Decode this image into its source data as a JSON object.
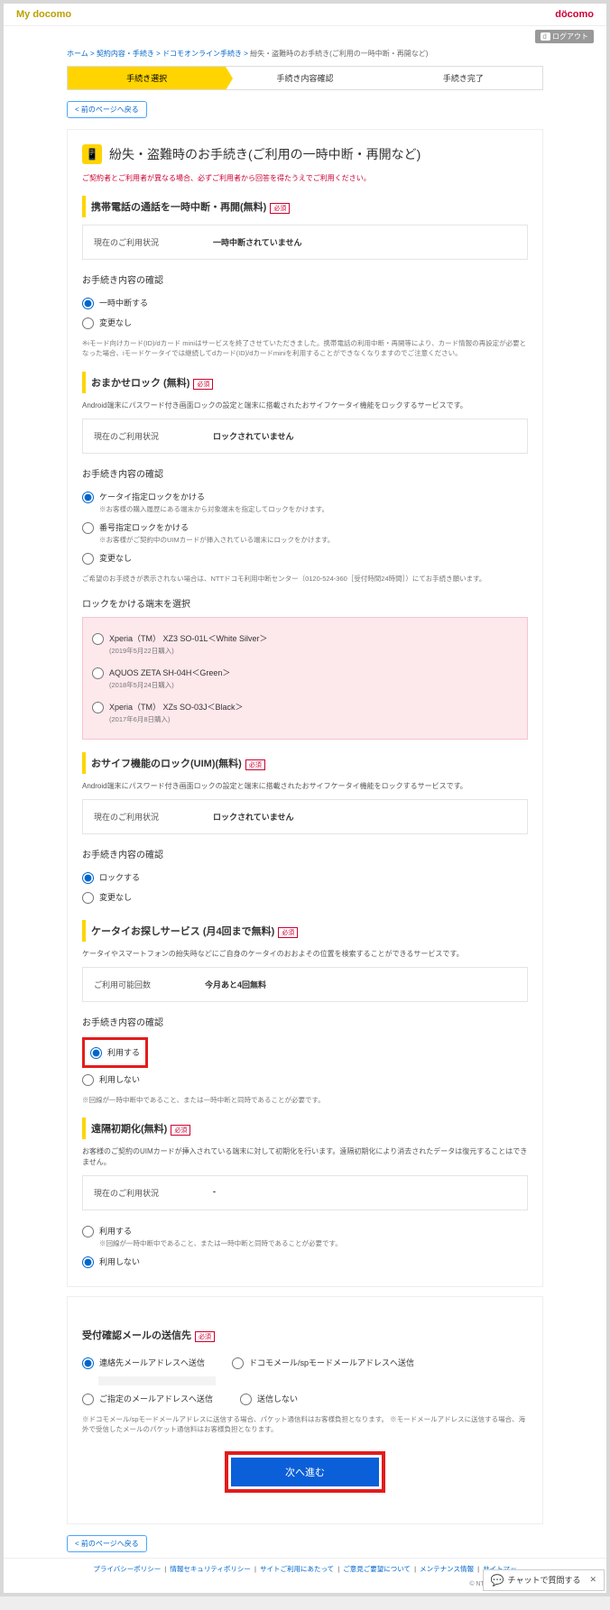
{
  "header": {
    "logo_my": "My docomo",
    "logo_d": "döcomo",
    "logout": "ログアウト"
  },
  "crumb": {
    "c1": "ホーム",
    "c2": "契約内容・手続き",
    "c3": "ドコモオンライン手続き",
    "c4": "紛失・盗難時のお手続き(ご利用の一時中断・再開など)"
  },
  "steps": {
    "s1": "手続き選択",
    "s2": "手続き内容確認",
    "s3": "手続き完了"
  },
  "back": "< 前のページへ戻る",
  "title": "紛失・盗難時のお手続き(ご利用の一時中断・再開など)",
  "warn": "ご契約者とご利用者が異なる場合、必ずご利用者から回答を得たうえでご利用ください。",
  "s1": {
    "h": "携帯電話の通話を一時中断・再開(無料)",
    "status_lbl": "現在のご利用状況",
    "status_val": "一時中断されていません",
    "confirm": "お手続き内容の確認",
    "r1": "一時中断する",
    "r2": "変更なし",
    "note": "※iモード向けカード(ID)/dカード miniはサービスを終了させていただきました。携帯電話の利用中断・再開等により、カード情報の再設定が必要となった場合、iモードケータイでは継続してdカード(ID)/dカードminiを利用することができなくなりますのでご注意ください。"
  },
  "s2": {
    "h": "おまかせロック (無料)",
    "desc": "Android端末にパスワード付き画面ロックの設定と端末に搭載されたおサイフケータイ機能をロックするサービスです。",
    "status_lbl": "現在のご利用状況",
    "status_val": "ロックされていません",
    "confirm": "お手続き内容の確認",
    "r1": "ケータイ指定ロックをかける",
    "r1s": "※お客様の購入履歴にある端末から対象端末を指定してロックをかけます。",
    "r2": "番号指定ロックをかける",
    "r2s": "※お客様がご契約中のUIMカードが挿入されている端末にロックをかけます。",
    "r3": "変更なし",
    "note": "ご希望のお手続きが表示されない場合は、NTTドコモ利用中断センター（0120-524-360［受付時間24時間］）にてお手続き願います。",
    "devh": "ロックをかける端末を選択",
    "d1": "Xperia（TM） XZ3 SO-01L＜White Silver＞",
    "d1s": "(2019年5月22日購入)",
    "d2": "AQUOS ZETA SH-04H＜Green＞",
    "d2s": "(2018年5月24日購入)",
    "d3": "Xperia（TM） XZs SO-03J＜Black＞",
    "d3s": "(2017年6月8日購入)"
  },
  "s3": {
    "h": "おサイフ機能のロック(UIM)(無料)",
    "desc": "Android端末にパスワード付き画面ロックの設定と端末に搭載されたおサイフケータイ機能をロックするサービスです。",
    "status_lbl": "現在のご利用状況",
    "status_val": "ロックされていません",
    "confirm": "お手続き内容の確認",
    "r1": "ロックする",
    "r2": "変更なし"
  },
  "s4": {
    "h": "ケータイお探しサービス (月4回まで無料)",
    "desc": "ケータイやスマートフォンの紛失時などにご自身のケータイのおおよその位置を検索することができるサービスです。",
    "count_lbl": "ご利用可能回数",
    "count_val": "今月あと4回無料",
    "confirm": "お手続き内容の確認",
    "r1": "利用する",
    "r2": "利用しない",
    "note": "※回線が一時中断中であること、または一時中断と同時であることが必要です。"
  },
  "s5": {
    "h": "遠隔初期化(無料)",
    "desc": "お客様のご契約のUIMカードが挿入されている端末に対して初期化を行います。遠隔初期化により消去されたデータは復元することはできません。",
    "status_lbl": "現在のご利用状況",
    "status_val": "-",
    "r1": "利用する",
    "r1s": "※回線が一時中断中であること、または一時中断と同時であることが必要です。",
    "r2": "利用しない"
  },
  "s6": {
    "h": "受付確認メールの送信先",
    "r1": "連絡先メールアドレスへ送信",
    "r2": "ドコモメール/spモードメールアドレスへ送信",
    "r3": "ご指定のメールアドレスへ送信",
    "r4": "送信しない",
    "note": "※ドコモメール/spモードメールアドレスに送信する場合、パケット通信料はお客様負担となります。\n※モードメールアドレスに送信する場合、海外で受信したメールのパケット通信料はお客様負担となります。"
  },
  "next": "次へ進む",
  "footer": {
    "l1": "プライバシーポリシー",
    "l2": "情報セキュリティポリシー",
    "l3": "サイトご利用にあたって",
    "l4": "ご意見ご要望について",
    "l5": "メンテナンス情報",
    "l6": "サイトマッ"
  },
  "copy": "© NTT DOCOMO, INC. All Rights Reserved.",
  "chat": "チャットで質問する",
  "req": "必須"
}
